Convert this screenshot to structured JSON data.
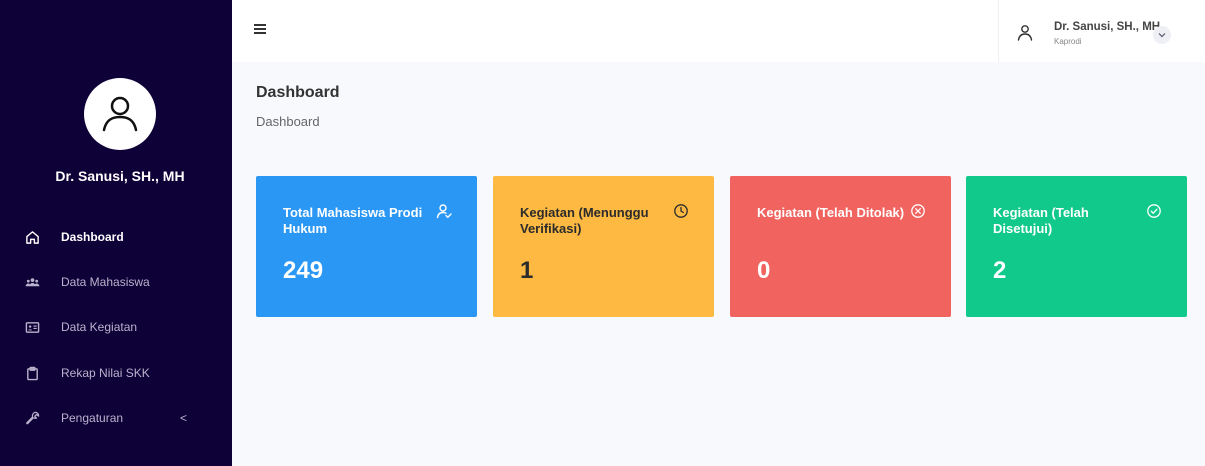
{
  "sidebar": {
    "user_name": "Dr. Sanusi, SH., MH",
    "items": [
      {
        "label": "Dashboard",
        "icon": "home-icon"
      },
      {
        "label": "Data Mahasiswa",
        "icon": "users-icon"
      },
      {
        "label": "Data Kegiatan",
        "icon": "id-card-icon"
      },
      {
        "label": "Rekap Nilai SKK",
        "icon": "clipboard-icon"
      },
      {
        "label": "Pengaturan",
        "icon": "wrench-icon",
        "expand": "<"
      }
    ]
  },
  "header": {
    "user_name": "Dr. Sanusi, SH., MH",
    "user_role": "Kaprodi"
  },
  "page": {
    "title": "Dashboard",
    "breadcrumb": "Dashboard"
  },
  "cards": [
    {
      "title": "Total Mahasiswa Prodi Hukum",
      "value": "249",
      "icon": "user-check-icon",
      "color": "#2a97f5"
    },
    {
      "title": "Kegiatan (Menunggu Verifikasi)",
      "value": "1",
      "icon": "clock-icon",
      "color": "#fdb942"
    },
    {
      "title": "Kegiatan (Telah Ditolak)",
      "value": "0",
      "icon": "x-circle-icon",
      "color": "#f0635f"
    },
    {
      "title": "Kegiatan (Telah Disetujui)",
      "value": "2",
      "icon": "check-circle-icon",
      "color": "#10c98a"
    }
  ]
}
